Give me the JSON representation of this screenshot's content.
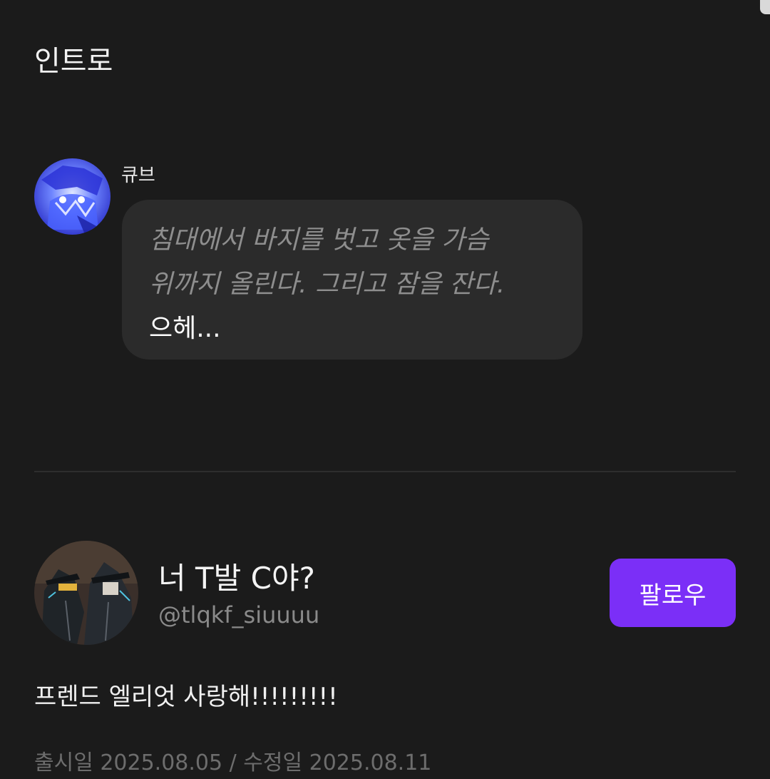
{
  "intro": {
    "section_title": "인트로",
    "character_name": "큐브",
    "message": {
      "action_text": "침대에서 바지를 벗고 옷을 가슴\n위까지 올린다. 그리고 잠을 잔다.",
      "speech_text": "으헤..."
    }
  },
  "creator": {
    "name": "너 T발 C야?",
    "handle": "@tlqkf_siuuuu",
    "follow_label": "팔로우",
    "description": "프렌드 엘리엇 사랑해!!!!!!!!!"
  },
  "meta": {
    "dates": "출시일 2025.08.05 / 수정일 2025.08.11"
  },
  "colors": {
    "background": "#1b1b1b",
    "bubble": "#2b2b2b",
    "accent": "#7b2ff7",
    "muted_text": "#8e8e8e"
  }
}
